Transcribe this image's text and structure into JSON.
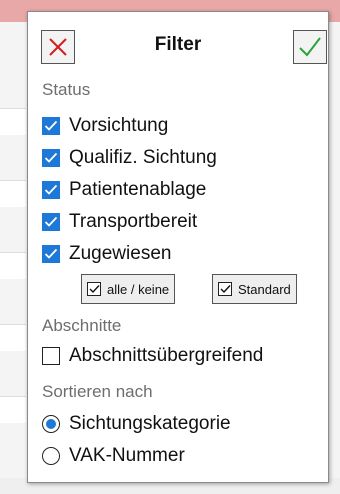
{
  "popup": {
    "title": "Filter",
    "close_icon": "close-x-icon",
    "ok_icon": "checkmark-icon",
    "close_color": "#d11f1f",
    "ok_color": "#2aa33a"
  },
  "status": {
    "label": "Status",
    "items": [
      {
        "label": "Vorsichtung",
        "checked": true
      },
      {
        "label": "Qualifiz. Sichtung",
        "checked": true
      },
      {
        "label": "Patientenablage",
        "checked": true
      },
      {
        "label": "Transportbereit",
        "checked": true
      },
      {
        "label": "Zugewiesen",
        "checked": true
      }
    ],
    "btn_all_none": "alle / keine",
    "btn_all_none_checked": true,
    "btn_standard": "Standard",
    "btn_standard_checked": true
  },
  "abschnitte": {
    "label": "Abschnitte",
    "item": {
      "label": "Abschnittsübergreifend",
      "checked": false
    }
  },
  "sort": {
    "label": "Sortieren nach",
    "options": [
      {
        "label": "Sichtungskategorie",
        "selected": true
      },
      {
        "label": "VAK-Nummer",
        "selected": false
      }
    ]
  },
  "colors": {
    "accent": "#1e78d7",
    "section_label": "#6e6e6e",
    "background_bar": "#e9a8a8"
  }
}
